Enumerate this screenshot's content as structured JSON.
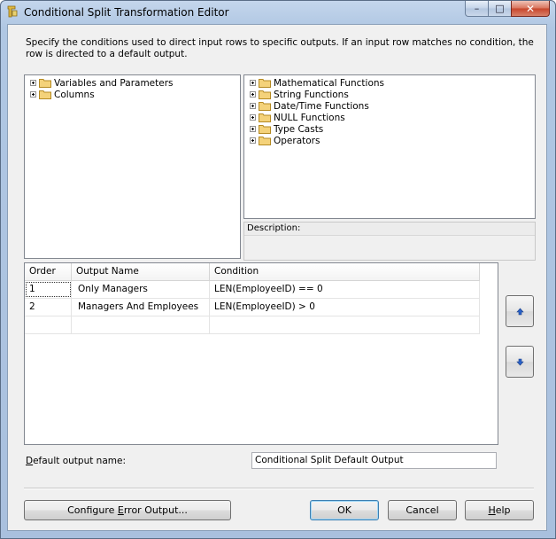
{
  "window": {
    "title": "Conditional Split Transformation Editor",
    "minimize_glyph": "–",
    "maximize_glyph": "□",
    "close_glyph": "✕"
  },
  "description": "Specify the conditions used to direct input rows to specific outputs. If an input row matches no condition, the row is directed to a default output.",
  "left_tree": [
    {
      "label": "Variables and Parameters",
      "icon": "folder-icon"
    },
    {
      "label": "Columns",
      "icon": "folder-icon"
    }
  ],
  "right_tree": [
    {
      "label": "Mathematical Functions",
      "icon": "folder-icon"
    },
    {
      "label": "String Functions",
      "icon": "folder-icon"
    },
    {
      "label": "Date/Time Functions",
      "icon": "folder-icon"
    },
    {
      "label": "NULL Functions",
      "icon": "folder-icon"
    },
    {
      "label": "Type Casts",
      "icon": "folder-icon"
    },
    {
      "label": "Operators",
      "icon": "folder-icon"
    }
  ],
  "description_box": {
    "label": "Description:",
    "value": ""
  },
  "grid": {
    "columns": [
      "Order",
      "Output Name",
      "Condition"
    ],
    "rows": [
      {
        "order": "1",
        "output_name": "Only Managers",
        "condition": "LEN(EmployeeID) == 0"
      },
      {
        "order": "2",
        "output_name": "Managers And Employees",
        "condition": "LEN(EmployeeID) > 0"
      },
      {
        "order": "",
        "output_name": "",
        "condition": ""
      }
    ]
  },
  "move_buttons": {
    "up_icon": "arrow-up-icon",
    "down_icon": "arrow-down-icon"
  },
  "default_output": {
    "label_prefix": "D",
    "label_rest": "efault output name:",
    "value": "Conditional Split Default Output"
  },
  "buttons": {
    "configure_error_prefix": "Configure ",
    "configure_error_mnemonic": "E",
    "configure_error_rest": "rror Output...",
    "ok": "OK",
    "cancel": "Cancel",
    "help_mnemonic": "H",
    "help_rest": "elp"
  },
  "colors": {
    "title_bar": "#b0c7e3",
    "client_bg": "#f0f0f0",
    "folder": "#e8c25a",
    "arrow": "#2a62c9",
    "close_button": "#c7452b"
  }
}
